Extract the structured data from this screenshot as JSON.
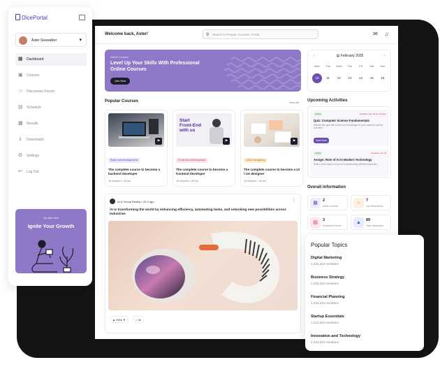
{
  "app": {
    "name": "DicePortal"
  },
  "user": {
    "name": "Aster Seawalker"
  },
  "sidebar": {
    "items": [
      {
        "label": "Dashboard",
        "icon": "dashboard-icon",
        "active": true
      },
      {
        "label": "Courses",
        "icon": "courses-icon",
        "active": false
      },
      {
        "label": "Discussion Forum",
        "icon": "forum-icon",
        "active": false
      },
      {
        "label": "Schedule",
        "icon": "calendar-icon",
        "active": false
      },
      {
        "label": "Results",
        "icon": "results-icon",
        "active": false
      },
      {
        "label": "Downloads",
        "icon": "download-icon",
        "active": false
      },
      {
        "label": "Settings",
        "icon": "gear-icon",
        "active": false
      },
      {
        "label": "Log Out",
        "icon": "logout-icon",
        "active": false
      }
    ],
    "promo": {
      "kicker": "Up skill now!",
      "title": "Ignite Your Growth"
    }
  },
  "header": {
    "welcome": "Welcome back, Aster!",
    "search_placeholder": "Search in People, Courses, Posts"
  },
  "banner": {
    "tag": "Online Course",
    "title": "Level Up Your Skills With Professional Online Courses",
    "cta": "Join Now"
  },
  "calendar": {
    "month": "February 2025",
    "days": [
      "Mon",
      "Tue",
      "Wed",
      "Thu",
      "Fri",
      "Sat",
      "Sun"
    ],
    "dates": [
      "10",
      "11",
      "12",
      "13",
      "14",
      "15",
      "16"
    ],
    "selected": "10"
  },
  "courses": {
    "title": "Popular Courses",
    "view_all": "View All",
    "items": [
      {
        "category": "Back-end development",
        "title": "The complete course to become a backend developer",
        "meta": "16 lessons  •  48 hrs"
      },
      {
        "category": "Front-end development",
        "title": "The complete course to become a frontend developer",
        "meta": "16 lessons  •  48 hrs",
        "thumb_text": "Start Front-End with us"
      },
      {
        "category": "UI/UX designing",
        "title": "The complete course to become a UI / UX designer",
        "meta": "16 lessons  •  48 hrs"
      }
    ]
  },
  "post": {
    "author": "AI & Virtual Reality",
    "time": "2h 5 ago",
    "text": "AI is transforming the world by enhancing efficiency, automating tasks, and unlocking new possibilities across industries",
    "likes": "390k",
    "comments": "36"
  },
  "activities": {
    "title": "Upcoming Activities",
    "items": [
      {
        "label": "Article",
        "deadline": "Deadline Feb 20 at 10:30am",
        "title": "Quiz: Computer Science Fundamentals",
        "desc": "Attempt this quiz with to test your knowledge of core computer science concepts.",
        "cta": "Start Now"
      },
      {
        "label": "Article",
        "deadline": "Deadline Jan 18",
        "title": "Assign: Role of AI in Modern Technology",
        "desc": "Write a short report on how AI is transforming different industries."
      }
    ]
  },
  "overview": {
    "title": "Overall Information",
    "items": [
      {
        "value": "2",
        "label": "Active Courses",
        "icon": "book-icon"
      },
      {
        "value": "7",
        "label": "Live Discussions",
        "icon": "chat-icon"
      },
      {
        "value": "3",
        "label": "Scheduled Events",
        "icon": "event-icon"
      },
      {
        "value": "89",
        "label": "Total Interactions",
        "icon": "thumbs-up-icon"
      }
    ]
  },
  "topics": {
    "title": "Popular Topics",
    "items": [
      {
        "name": "Digital Marketing",
        "members": "1,234,343 members"
      },
      {
        "name": "Business Strategy",
        "members": "1,234,343 members"
      },
      {
        "name": "Financial Planning",
        "members": "1,234,343 members"
      },
      {
        "name": "Startup Essentials",
        "members": "1,314,343 members"
      },
      {
        "name": "Innovation and Technology",
        "members": "1,234,343 members"
      }
    ]
  },
  "colors": {
    "accent": "#8f78c8",
    "accent_dark": "#6a4fb3",
    "dark": "#1c1c2a"
  }
}
